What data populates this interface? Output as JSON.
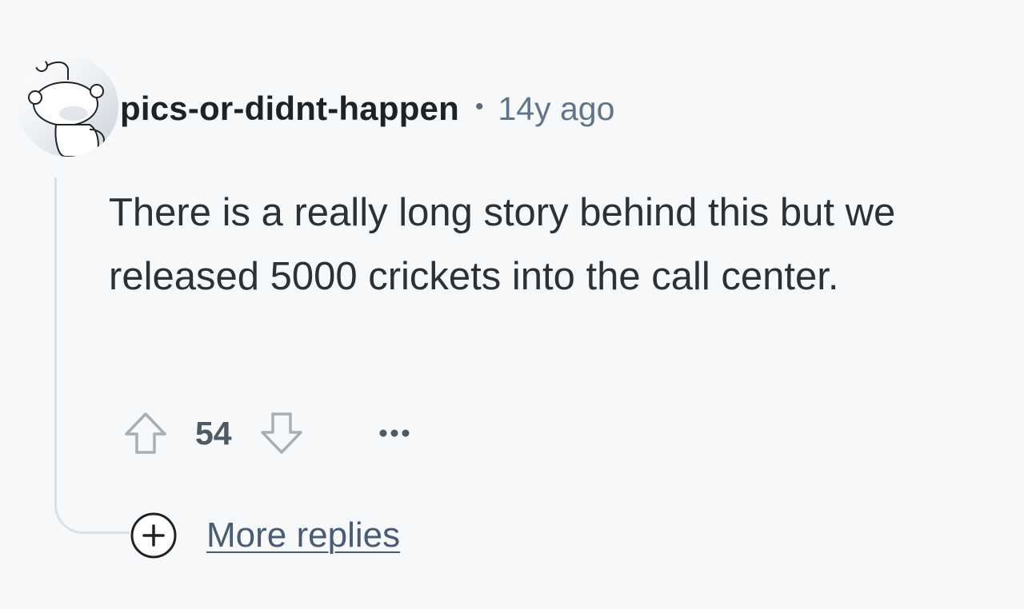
{
  "comment": {
    "username": "pics-or-didnt-happen",
    "separator": "•",
    "time_ago": "14y ago",
    "body": "There is a really long story behind this but we released 5000 crickets into the call center.",
    "score": "54",
    "more_replies_label": "More replies"
  },
  "icons": {
    "avatar": "snoo-avatar-icon",
    "upvote": "upvote-arrow-icon",
    "downvote": "downvote-arrow-icon",
    "more": "ellipsis-icon",
    "expand": "plus-circle-icon"
  },
  "colors": {
    "background": "#f7f8fa",
    "username": "#1c2226",
    "time": "#5f7589",
    "body_text": "#2a3236",
    "score": "#4d5963",
    "icon_stroke": "#a7aeb4",
    "thread_line": "#d9e1e7",
    "link": "#485c73"
  }
}
